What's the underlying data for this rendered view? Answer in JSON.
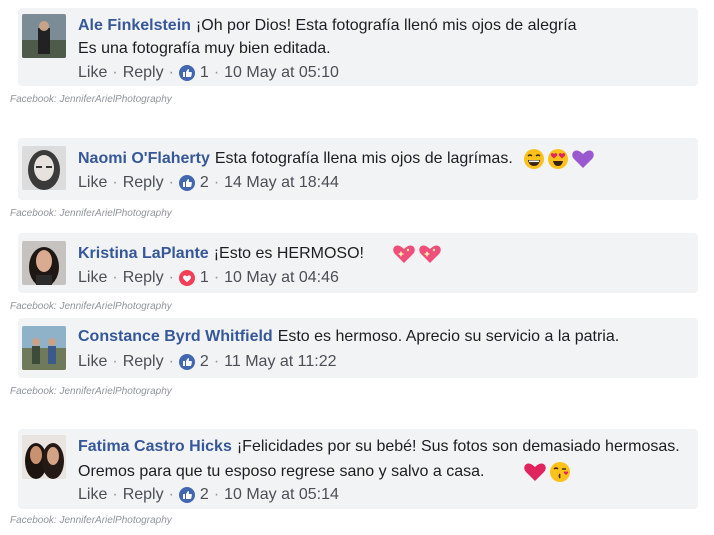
{
  "credit": "Facebook: JenniferArielPhotography",
  "actions": {
    "like": "Like",
    "reply": "Reply",
    "separator": "·"
  },
  "comments": [
    {
      "name": "Ale Finkelstein",
      "text": "¡Oh por Dios! Esta fotografía llenó mis ojos de alegría",
      "text2": "Es una fotografía muy bien editada.",
      "reaction": "like-icon",
      "count": "1",
      "time": "10 May at 05:10"
    },
    {
      "name": "Naomi O'Flaherty",
      "text": "Esta fotografía llena mis ojos de lagrímas.",
      "emojis": [
        "grinning-face-icon",
        "heart-eyes-icon",
        "purple-heart-icon"
      ],
      "reaction": "like-icon",
      "count": "2",
      "time": "14 May at 18:44"
    },
    {
      "name": "Kristina LaPlante",
      "text": "¡Esto es HERMOSO!",
      "emojis": [
        "sparkling-heart-icon",
        "sparkling-heart-icon"
      ],
      "reaction": "love-icon",
      "count": "1",
      "time": "10 May at 04:46"
    },
    {
      "name": "Constance Byrd Whitfield",
      "text": "Esto es hermoso. Aprecio su servicio a la patria.",
      "reaction": "like-icon",
      "count": "2",
      "time": "11 May at 11:22"
    },
    {
      "name": "Fatima Castro Hicks",
      "text": "¡Felicidades por su bebé! Sus fotos son demasiado hermosas.",
      "text2": "Oremos para que tu esposo regrese sano y salvo a casa.",
      "emojis": [
        "red-heart-icon",
        "kissing-face-icon"
      ],
      "reaction": "like-icon",
      "count": "2",
      "time": "10 May at 05:14"
    }
  ],
  "colors": {
    "name": "#365899",
    "bubble": "#f2f3f5",
    "like": "#4267b2",
    "love": "#f33e58",
    "meta": "#4b4f56"
  }
}
